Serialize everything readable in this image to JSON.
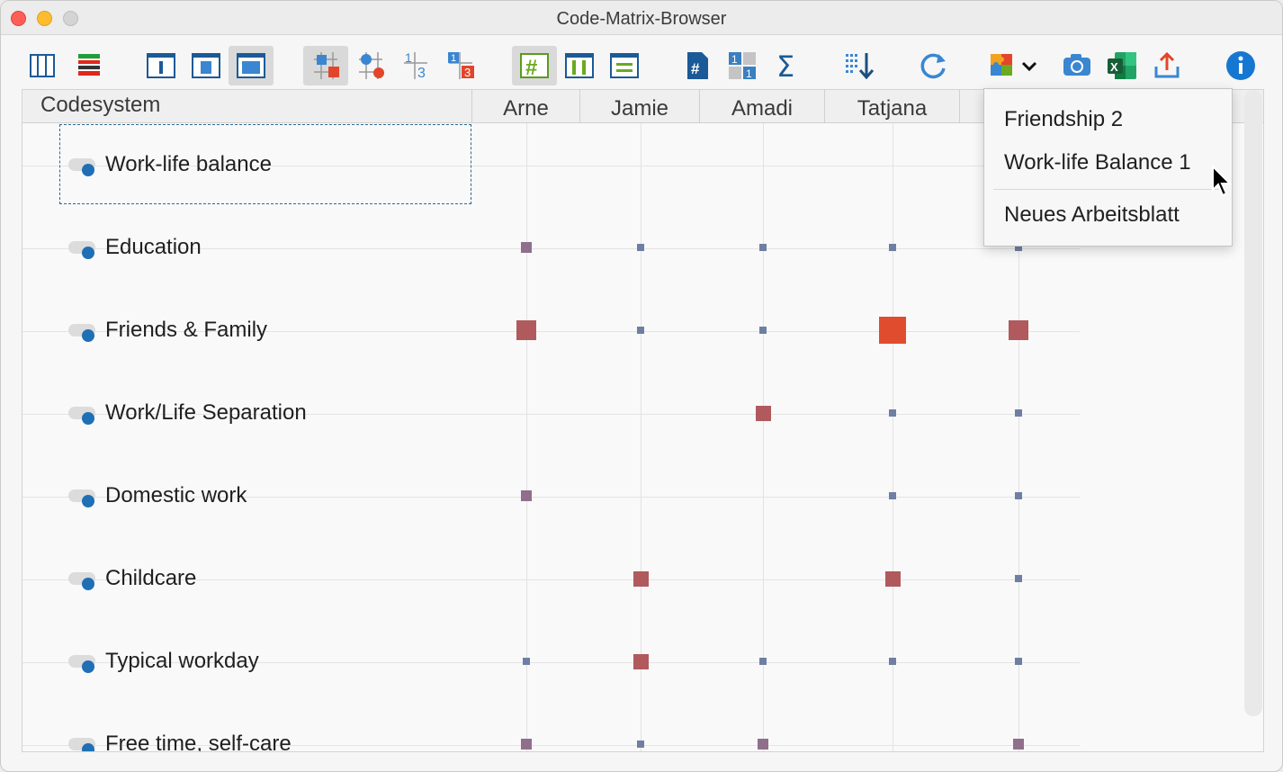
{
  "window": {
    "title": "Code-Matrix-Browser"
  },
  "toolbar": {
    "icons": [
      "columns-layout-icon",
      "code-colors-icon",
      "pane-left-icon",
      "pane-center-icon",
      "pane-full-icon",
      "squares-visual-icon",
      "circles-visual-icon",
      "numbers-visual-icon",
      "numbers-colored-icon",
      "hash-grid-icon",
      "column-grid-icon",
      "row-grid-icon",
      "document-hash-icon",
      "matrix-numbers-icon",
      "sigma-icon",
      "sort-down-icon",
      "refresh-icon",
      "puzzle-icon",
      "chevron-down-icon",
      "camera-icon",
      "excel-icon",
      "export-icon",
      "info-icon"
    ]
  },
  "matrix": {
    "code_header": "Codesystem",
    "columns": [
      "Arne",
      "Jamie",
      "Amadi",
      "Tatjana"
    ],
    "rows": [
      {
        "label": "Work-life balance",
        "cells": [
          0,
          0,
          0,
          0,
          0
        ]
      },
      {
        "label": "Education",
        "cells": [
          2,
          1,
          1,
          1,
          1
        ]
      },
      {
        "label": "Friends & Family",
        "cells": [
          4,
          1,
          1,
          5,
          4
        ]
      },
      {
        "label": "Work/Life Separation",
        "cells": [
          0,
          0,
          3,
          1,
          1
        ]
      },
      {
        "label": "Domestic work",
        "cells": [
          2,
          0,
          0,
          1,
          1
        ]
      },
      {
        "label": "Childcare",
        "cells": [
          0,
          3,
          0,
          3,
          1
        ]
      },
      {
        "label": "Typical workday",
        "cells": [
          1,
          3,
          1,
          1,
          1
        ]
      },
      {
        "label": "Free time, self-care",
        "cells": [
          2,
          1,
          2,
          0,
          2
        ]
      }
    ],
    "colors": {
      "small": "#6e7fa3",
      "medium": "#8f6f8c",
      "large": "#b05a5e",
      "xlarge": "#e04d2e"
    }
  },
  "dropdown": {
    "items": [
      "Friendship 2",
      "Work-life Balance 1",
      "Neues Arbeitsblatt"
    ]
  }
}
